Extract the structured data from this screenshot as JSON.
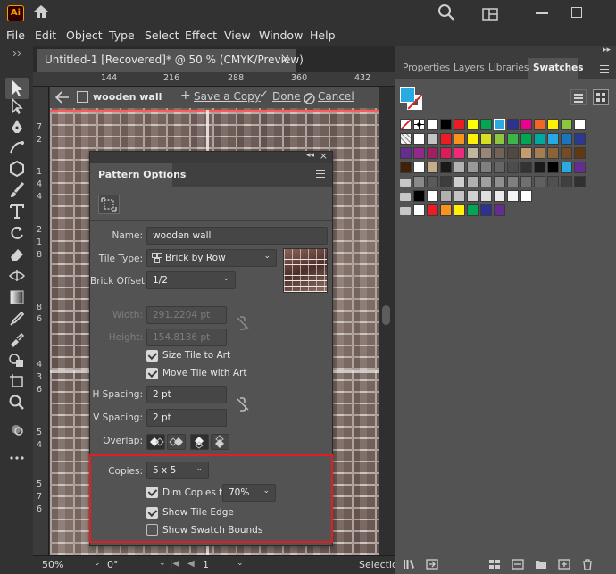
{
  "menu": [
    "File",
    "Edit",
    "Object",
    "Type",
    "Select",
    "Effect",
    "View",
    "Window",
    "Help"
  ],
  "app_logo": "Ai",
  "document_tab": {
    "title": "Untitled-1 [Recovered]* @ 50 % (CMYK/Preview)",
    "close": "×"
  },
  "ruler_top": [
    "144",
    "216",
    "288",
    "360",
    "432"
  ],
  "ruler_left": [
    "7",
    "2",
    "1",
    "4",
    "4",
    "2",
    "1",
    "8",
    "8",
    "6",
    "4",
    "3",
    "6",
    "5",
    "4",
    "5",
    "7",
    "6"
  ],
  "isolation_bar": {
    "pattern_name": "wooden wall",
    "save_copy": "Save a Copy",
    "done": "Done",
    "cancel": "Cancel"
  },
  "status_bar": {
    "zoom": "50%",
    "rotation": "0°",
    "artboard": "1",
    "tool": "Selectio"
  },
  "pattern_options": {
    "panel_title": "Pattern Options",
    "name_label": "Name:",
    "name_value": "wooden wall",
    "tile_type_label": "Tile Type:",
    "tile_type_value": "Brick by Row",
    "brick_offset_label": "Brick Offset:",
    "brick_offset_value": "1/2",
    "width_label": "Width:",
    "width_value": "291.2204 pt",
    "height_label": "Height:",
    "height_value": "154.8136 pt",
    "size_tile_to_art": "Size Tile to Art",
    "move_tile_with_art": "Move Tile with Art",
    "h_spacing_label": "H Spacing:",
    "h_spacing_value": "2 pt",
    "v_spacing_label": "V Spacing:",
    "v_spacing_value": "2 pt",
    "overlap_label": "Overlap:",
    "copies_label": "Copies:",
    "copies_value": "5 x 5",
    "dim_copies_label": "Dim Copies to:",
    "dim_copies_value": "70%",
    "show_tile_edge": "Show Tile Edge",
    "show_swatch_bounds": "Show Swatch Bounds",
    "checks": {
      "size_tile_to_art": true,
      "move_tile_with_art": true,
      "dim_copies": true,
      "show_tile_edge": true,
      "show_swatch_bounds": false
    }
  },
  "right_panel": {
    "tabs": [
      "Properties",
      "Layers",
      "Libraries",
      "Swatches"
    ],
    "active_tab": "Swatches",
    "fill_color": "#29abe2"
  },
  "swatch_rows": [
    [
      "none",
      "reg",
      "#ffffff",
      "#000000",
      "#ed1c24",
      "#ffff00",
      "#00a651",
      "#29abe2",
      "#2e3192",
      "#ec008c",
      "#f26522",
      "#fff200",
      "#8dc63f",
      "#ffffff"
    ],
    [
      "pattern",
      "#ffffff",
      "#c4c4c4",
      "#ed1c24",
      "#f7941d",
      "#fff200",
      "#d7df23",
      "#8dc63f",
      "#39b54a",
      "#00a651",
      "#00a99d",
      "#27aae1",
      "#1c75bc",
      "#2b3990"
    ],
    [
      "#662d91",
      "#92278f",
      "#9e1f63",
      "#da1c5c",
      "#ee2a7b",
      "#c2b59b",
      "#998675",
      "#736357",
      "#534741",
      "#c69c6d",
      "#a67c52",
      "#8c6239",
      "#754c24",
      "#603913"
    ],
    [
      "#42210b",
      "#ffffff",
      "#c6ab8b",
      "#1a1a1a",
      "#b3b3b3",
      "#999999",
      "#808080",
      "#666666",
      "#4d4d4d",
      "#333333",
      "#1a1a1a",
      "#000000",
      "#29abe2",
      "#662d91"
    ],
    [
      "#8a8a8a",
      "#5a5a5a",
      "#3d3d3d",
      "#cfcfcf",
      "#b0b0b0",
      "#a0a0a0",
      "#909090",
      "#808080",
      "#707070",
      "#606060",
      "#505050",
      "#404040",
      "#303030"
    ],
    [
      "#000000",
      "#ffffff",
      "#b0b0b0",
      "#c4c4c4",
      "#d0d0d0",
      "#dedede",
      "#eaeaea",
      "#f4f4f4",
      "#ffffff"
    ],
    [
      "#ffffff",
      "#ed1c24",
      "#f7941d",
      "#fff200",
      "#00a651",
      "#2e3192",
      "#662d91"
    ]
  ]
}
